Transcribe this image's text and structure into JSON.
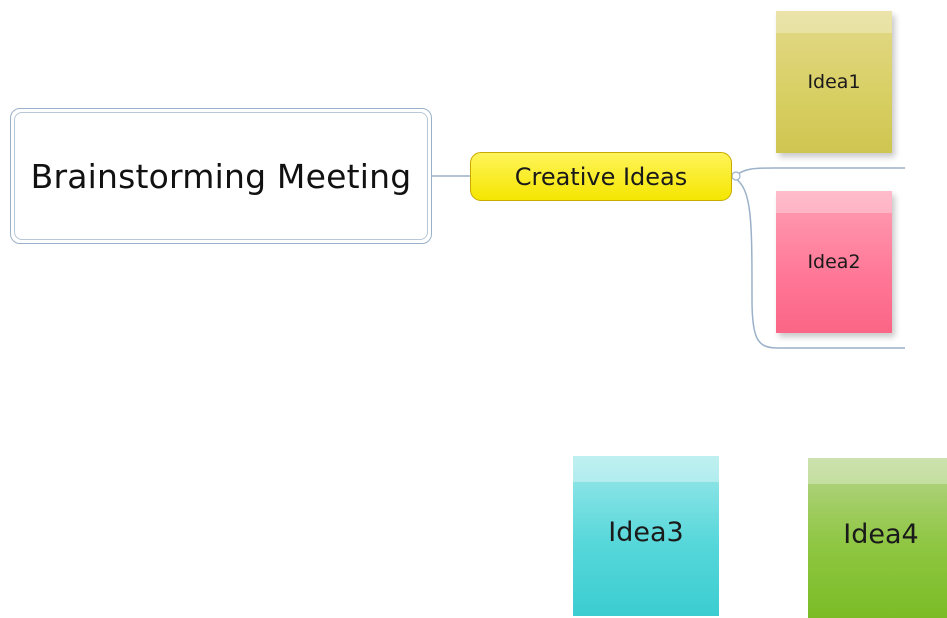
{
  "mindmap": {
    "central_topic": "Brainstorming Meeting",
    "main_topic": "Creative Ideas",
    "notes": [
      {
        "label": "Idea1",
        "color": "#d8cf63"
      },
      {
        "label": "Idea2",
        "color": "#ff7796"
      },
      {
        "label": "Idea3",
        "color": "#56d7da"
      },
      {
        "label": "Idea4",
        "color": "#8ec641"
      }
    ]
  },
  "colors": {
    "main_topic_fill": "#f4e600",
    "connector": "#9bb1c9"
  }
}
